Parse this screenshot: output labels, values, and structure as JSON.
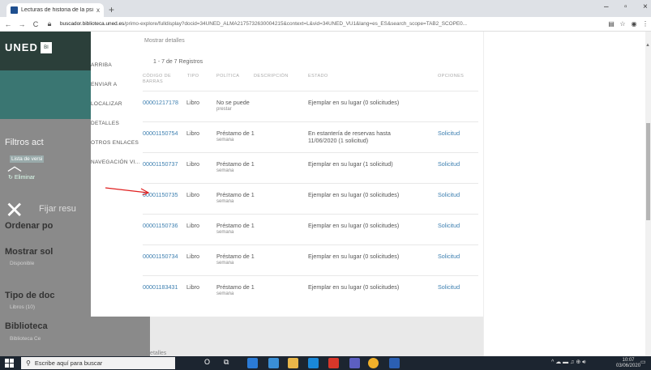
{
  "browser": {
    "tab_title": "Lecturas de historia de la psicolo",
    "tab_close": "x",
    "new_tab": "+",
    "url_host": "buscador.biblioteca.uned.es",
    "url_path": "/primo-explore/fulldisplay?docid=34UNED_ALMA2175732630004215&context=L&vid=34UNED_VU1&lang=es_ES&search_scope=TAB2_SCOPE0...",
    "win_min": "–",
    "win_max": "▫",
    "win_close": "×"
  },
  "sidebar": {
    "filtros": "Filtros act",
    "lista": "Lista de versi",
    "eliminar": "Eliminar",
    "fijar": "Fijar resu",
    "ordenar": "Ordenar po",
    "mostrar": "Mostrar sol",
    "disponible": "Disponible",
    "tipo": "Tipo de doc",
    "libros": "Libros (10)",
    "biblioteca": "Biblioteca",
    "biblioteca_sub": "Biblioteca Ce"
  },
  "detail_menu": [
    "ARRIBA",
    "ENVIAR A",
    "LOCALIZAR",
    "DETALLES",
    "OTROS ENLACES",
    "NAVEGACIÓN VI..."
  ],
  "mostrar_detalles": "Mostrar detalles",
  "results_count": "1 - 7 de 7 Registros",
  "headers": {
    "codigo": "CÓDIGO DE BARRAS",
    "tipo": "TIPO",
    "politica": "POLÍTICA",
    "recepcion": "DESCRIPCIÓN",
    "estado": "ESTADO",
    "opciones": "OPCIONES"
  },
  "rows": [
    {
      "code": "00001217178",
      "tipo": "Libro",
      "pol": "No se puede",
      "pol2": "prestar",
      "estado": "Ejemplar en su lugar (0 solicitudes)",
      "estado2": "",
      "sol": ""
    },
    {
      "code": "00001150754",
      "tipo": "Libro",
      "pol": "Préstamo de 1",
      "pol2": "semana",
      "estado": "En estantería de reservas hasta",
      "estado2": "11/06/2020 (1 solicitud)",
      "sol": "Solicitud"
    },
    {
      "code": "00001150737",
      "tipo": "Libro",
      "pol": "Préstamo de 1",
      "pol2": "semana",
      "estado": "Ejemplar en su lugar (1 solicitud)",
      "estado2": "",
      "sol": "Solicitud"
    },
    {
      "code": "00001150735",
      "tipo": "Libro",
      "pol": "Préstamo de 1",
      "pol2": "semana",
      "estado": "Ejemplar en su lugar (0 solicitudes)",
      "estado2": "",
      "sol": "Solicitud"
    },
    {
      "code": "00001150736",
      "tipo": "Libro",
      "pol": "Préstamo de 1",
      "pol2": "semana",
      "estado": "Ejemplar en su lugar (0 solicitudes)",
      "estado2": "",
      "sol": "Solicitud"
    },
    {
      "code": "00001150734",
      "tipo": "Libro",
      "pol": "Préstamo de 1",
      "pol2": "semana",
      "estado": "Ejemplar en su lugar (0 solicitudes)",
      "estado2": "",
      "sol": "Solicitud"
    },
    {
      "code": "00001183431",
      "tipo": "Libro",
      "pol": "Préstamo de 1",
      "pol2": "semana",
      "estado": "Ejemplar en su lugar (0 solicitudes)",
      "estado2": "",
      "sol": "Solicitud"
    }
  ],
  "detalles_footer": "Detalles",
  "taskbar": {
    "search_placeholder": "Escribe aquí para buscar",
    "time": "10:07",
    "date": "03/06/2020"
  },
  "colors": {
    "accent": "#3d7fb0",
    "uned": "#2b3f3a",
    "arrow": "#e02020"
  }
}
